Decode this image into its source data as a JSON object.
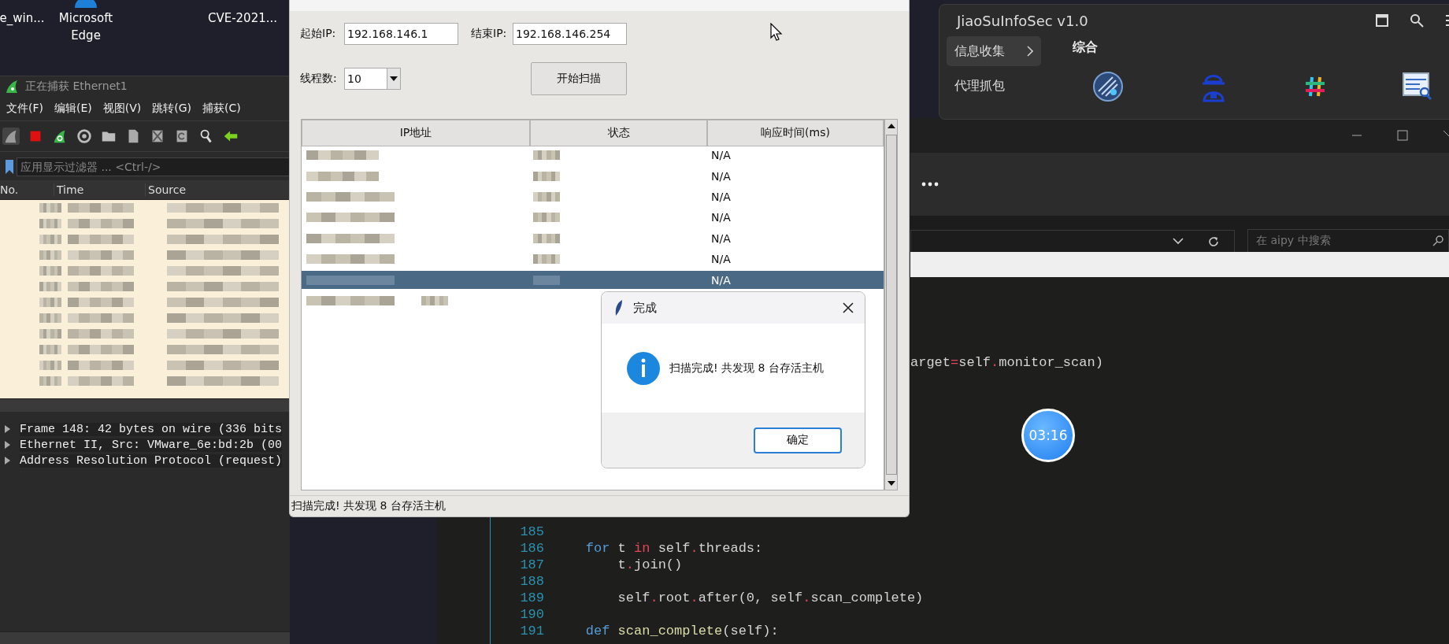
{
  "desktop_icons": [
    {
      "label": "e_win..."
    },
    {
      "label": "Microsoft Edge"
    },
    {
      "label": "CVE-2021..."
    }
  ],
  "wireshark": {
    "title": "正在捕获 Ethernet1",
    "menu": [
      "文件(F)",
      "编辑(E)",
      "视图(V)",
      "跳转(G)",
      "捕获(C)"
    ],
    "filter": {
      "placeholder": "应用显示过滤器 ... <Ctrl-/>"
    },
    "columns": [
      "No.",
      "Time",
      "Source"
    ],
    "details": [
      "Frame 148: 42 bytes on wire (336 bits",
      "Ethernet II, Src: VMware_6e:bd:2b (00",
      "Address Resolution Protocol (request)"
    ]
  },
  "tool_window": {
    "title": "JiaoSuInfoSec v1.0",
    "categories": [
      {
        "label": "信息收集",
        "selected": true
      },
      {
        "label": "代理抓包",
        "selected": false
      }
    ],
    "section": "综合"
  },
  "explorer": {
    "search": {
      "placeholder": "在 aipy 中搜索"
    }
  },
  "editor": {
    "partial_line": [
      {
        "t": "arget"
      },
      {
        "t": "=",
        "kind": "operator"
      },
      {
        "t": "self"
      },
      {
        "t": ".",
        "kind": "operator"
      },
      {
        "t": "monitor_scan)"
      }
    ],
    "lines": [
      {
        "number": "185"
      },
      {
        "number": "186",
        "tokens": [
          {
            "t": "    for",
            "kind": "keyword"
          },
          {
            "t": " t "
          },
          {
            "t": "in",
            "kind": "operator"
          },
          {
            "t": " self"
          },
          {
            "t": ".",
            "kind": "operator"
          },
          {
            "t": "threads:"
          }
        ]
      },
      {
        "number": "187",
        "tokens": [
          {
            "t": "        t"
          },
          {
            "t": ".",
            "kind": "operator"
          },
          {
            "t": "join()"
          }
        ]
      },
      {
        "number": "188"
      },
      {
        "number": "189",
        "tokens": [
          {
            "t": "        self"
          },
          {
            "t": ".",
            "kind": "operator"
          },
          {
            "t": "root"
          },
          {
            "t": ".",
            "kind": "operator"
          },
          {
            "t": "after(0, self"
          },
          {
            "t": ".",
            "kind": "operator"
          },
          {
            "t": "scan_complete)"
          }
        ]
      },
      {
        "number": "190"
      },
      {
        "number": "191",
        "tokens": [
          {
            "t": "    def",
            "kind": "keyword"
          },
          {
            "t": " scan_complete",
            "kind": "function"
          },
          {
            "t": "(self):"
          }
        ]
      }
    ]
  },
  "scanner": {
    "start_ip_label": "起始IP:",
    "start_ip": "192.168.146.1",
    "end_ip_label": "结束IP:",
    "end_ip": "192.168.146.254",
    "threads_label": "线程数:",
    "threads": "10",
    "scan_button": "开始扫描",
    "columns": [
      "IP地址",
      "状态",
      "响应时间(ms)"
    ],
    "rows": [
      {
        "response": "N/A",
        "selected": false
      },
      {
        "response": "N/A",
        "selected": false
      },
      {
        "response": "N/A",
        "selected": false
      },
      {
        "response": "N/A",
        "selected": false
      },
      {
        "response": "N/A",
        "selected": false
      },
      {
        "response": "N/A",
        "selected": false
      },
      {
        "response": "N/A",
        "selected": true
      },
      {
        "selected": false
      }
    ],
    "status": "扫描完成! 共发现 8 台存活主机"
  },
  "dialog": {
    "title": "完成",
    "message": "扫描完成! 共发现 8 台存活主机",
    "ok_button": "确定"
  },
  "timer": "03:16"
}
